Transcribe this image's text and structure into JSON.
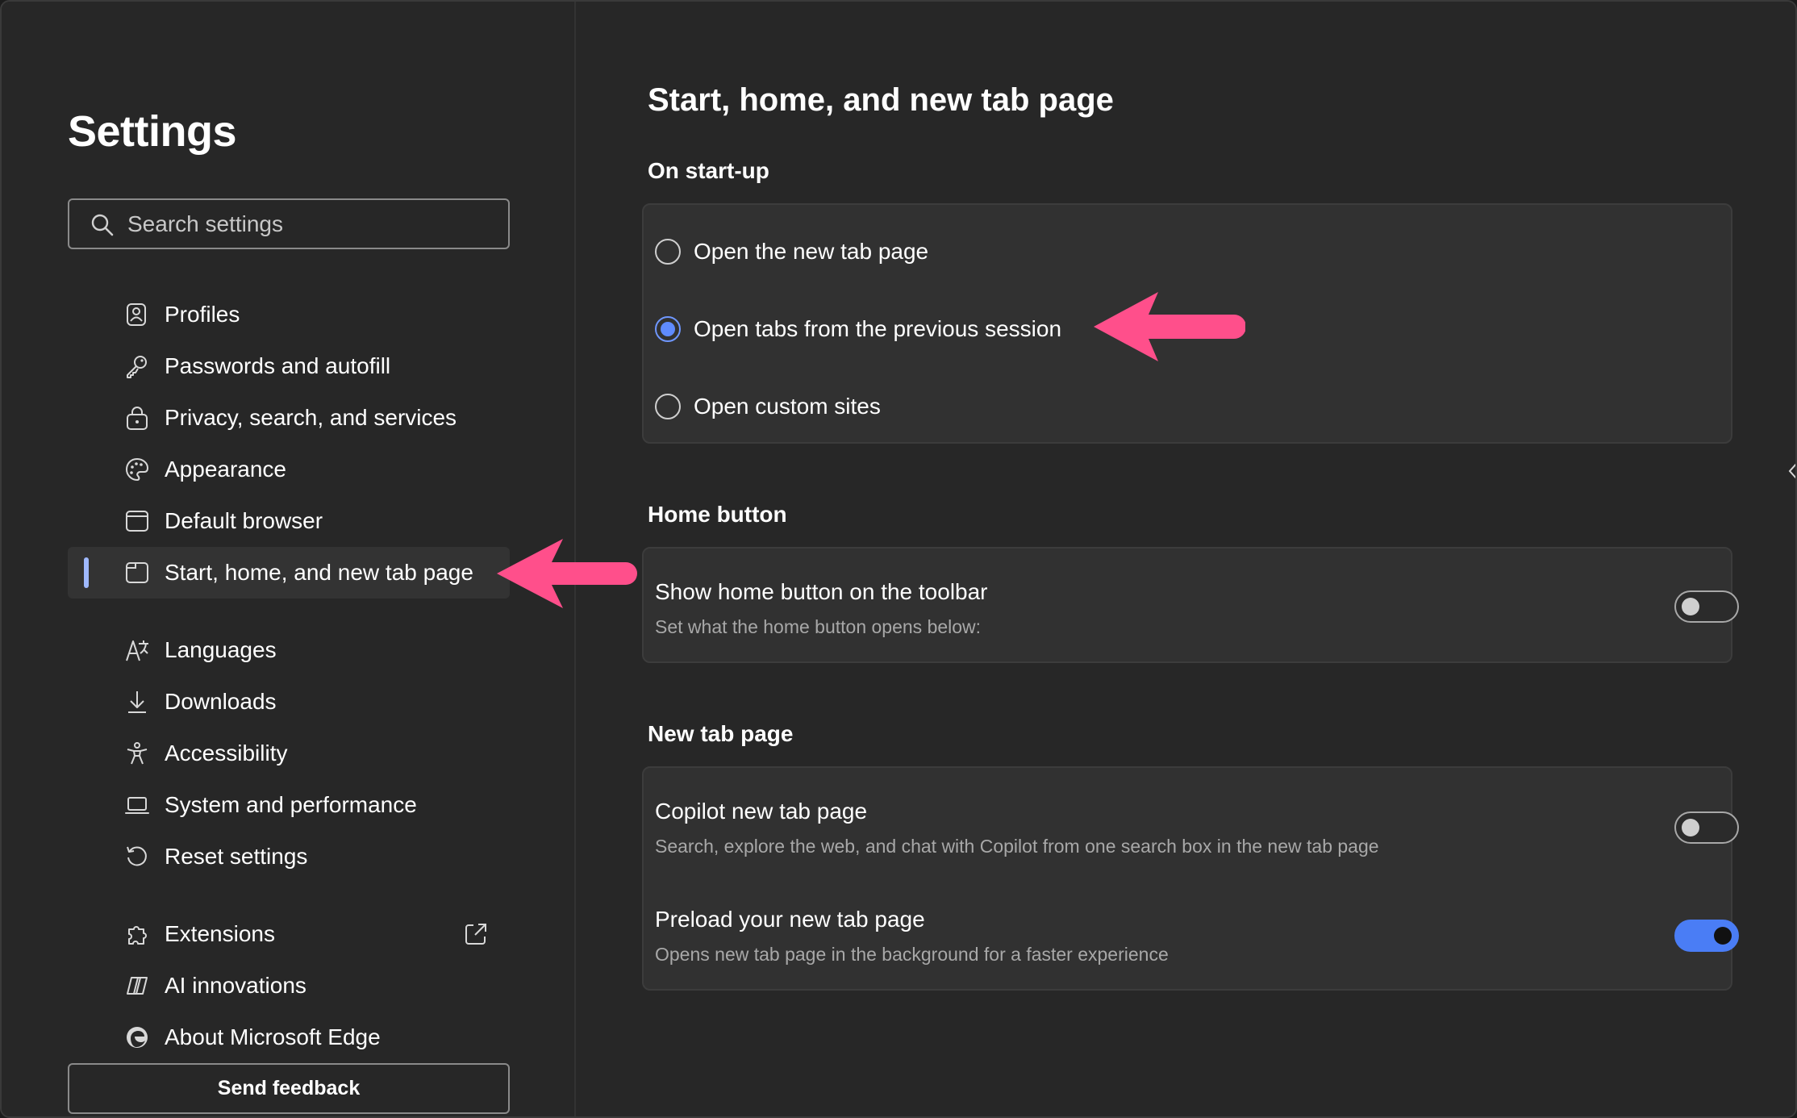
{
  "colors": {
    "background": "#272727",
    "card": "#313131",
    "accent": "#5f8bff",
    "nav_indicator": "#9fb9ff",
    "annotation_arrow": "#ff4f8b",
    "toggle_on": "#4a7df5"
  },
  "sidebar": {
    "title": "Settings",
    "search": {
      "placeholder": "Search settings",
      "value": "",
      "icon": "search-icon"
    },
    "items": [
      {
        "label": "Profiles",
        "icon": "profile-icon",
        "active": false
      },
      {
        "label": "Passwords and autofill",
        "icon": "key-icon",
        "active": false
      },
      {
        "label": "Privacy, search, and services",
        "icon": "lock-icon",
        "active": false
      },
      {
        "label": "Appearance",
        "icon": "palette-icon",
        "active": false
      },
      {
        "label": "Default browser",
        "icon": "browser-window-icon",
        "active": false
      },
      {
        "label": "Start, home, and new tab page",
        "icon": "tab-page-icon",
        "active": true
      },
      {
        "label": "Languages",
        "icon": "language-icon",
        "active": false
      },
      {
        "label": "Downloads",
        "icon": "download-icon",
        "active": false
      },
      {
        "label": "Accessibility",
        "icon": "accessibility-icon",
        "active": false
      },
      {
        "label": "System and performance",
        "icon": "laptop-icon",
        "active": false
      },
      {
        "label": "Reset settings",
        "icon": "reset-icon",
        "active": false
      },
      {
        "label": "Extensions",
        "icon": "puzzle-icon",
        "active": false,
        "external": "open-external-icon"
      },
      {
        "label": "AI innovations",
        "icon": "copilot-icon",
        "active": false
      },
      {
        "label": "About Microsoft Edge",
        "icon": "edge-logo-icon",
        "active": false
      }
    ],
    "feedback_label": "Send feedback"
  },
  "main": {
    "title": "Start, home, and new tab page",
    "startup": {
      "heading": "On start-up",
      "options": [
        {
          "label": "Open the new tab page",
          "checked": false
        },
        {
          "label": "Open tabs from the previous session",
          "checked": true
        },
        {
          "label": "Open custom sites",
          "checked": false
        }
      ]
    },
    "home_button": {
      "heading": "Home button",
      "title": "Show home button on the toolbar",
      "description": "Set what the home button opens below:",
      "enabled": false
    },
    "new_tab": {
      "heading": "New tab page",
      "settings": [
        {
          "title": "Copilot new tab page",
          "description": "Search, explore the web, and chat with Copilot from one search box in the new tab page",
          "enabled": false
        },
        {
          "title": "Preload your new tab page",
          "description": "Opens new tab page in the background for a faster experience",
          "enabled": true
        }
      ]
    }
  }
}
